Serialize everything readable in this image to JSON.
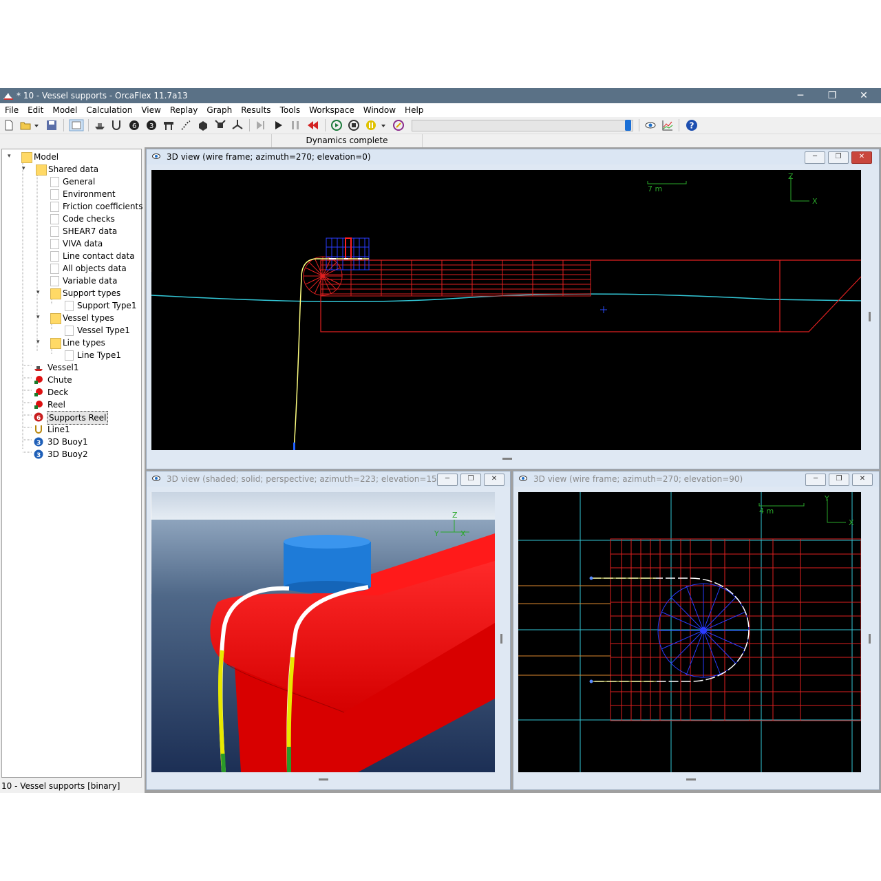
{
  "window": {
    "title": "* 10 - Vessel supports - OrcaFlex 11.7a13",
    "minimize_glyph": "─",
    "restore_glyph": "❐",
    "close_glyph": "✕"
  },
  "menu": [
    "File",
    "Edit",
    "Model",
    "Calculation",
    "View",
    "Replay",
    "Graph",
    "Results",
    "Tools",
    "Workspace",
    "Window",
    "Help"
  ],
  "status_message": "Dynamics complete",
  "statusbar": "10 - Vessel supports [binary]",
  "tree": {
    "root": "Model",
    "shared_data": "Shared data",
    "items": [
      "General",
      "Environment",
      "Friction coefficients",
      "Code checks",
      "SHEAR7 data",
      "VIVA data",
      "Line contact data",
      "All objects data",
      "Variable data"
    ],
    "support_types": "Support types",
    "support_type1": "Support Type1",
    "vessel_types": "Vessel types",
    "vessel_type1": "Vessel Type1",
    "line_types": "Line types",
    "line_type1": "Line Type1",
    "objects": [
      "Vessel1",
      "Chute",
      "Deck",
      "Reel",
      "Supports Reel",
      "Line1",
      "3D Buoy1",
      "3D Buoy2"
    ],
    "selected": "Supports Reel"
  },
  "views": {
    "top": {
      "title": "3D view (wire frame; azimuth=270; elevation=0)",
      "scale_label": "7 m",
      "axis_v": "Z",
      "axis_h": "X"
    },
    "bottom_left": {
      "title": "3D view (shaded; solid; perspective; azimuth=223; elevation=15)",
      "axis_z": "Z",
      "axis_y": "Y",
      "axis_x": "X"
    },
    "bottom_right": {
      "title": "3D view (wire frame; azimuth=270; elevation=90)",
      "scale_label": "4 m",
      "axis_v": "Y",
      "axis_h": "X"
    }
  },
  "colors": {
    "vessel_wire": "#e02020",
    "sea_surface": "#33c8d8",
    "support_wire": "#2a3cff",
    "line_color": "#ffff80",
    "reel_shaded": "#ff1010",
    "buoy_shaded": "#1e7bd8"
  }
}
